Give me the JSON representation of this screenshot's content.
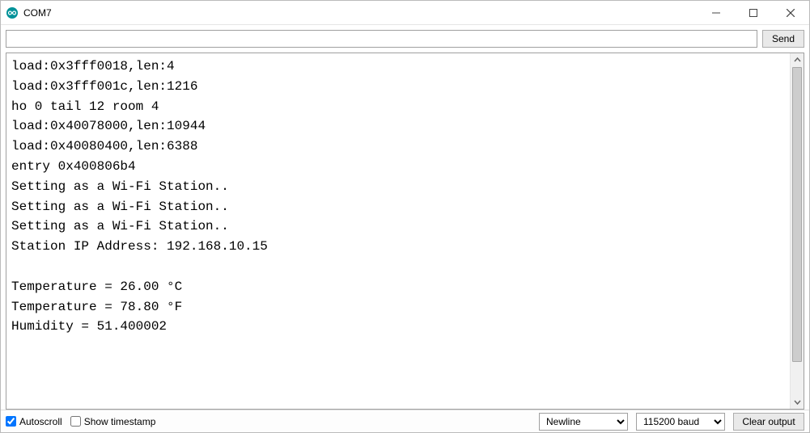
{
  "window": {
    "title": "COM7"
  },
  "input": {
    "command_value": "",
    "send_label": "Send"
  },
  "console": {
    "lines": [
      "load:0x3fff0018,len:4",
      "load:0x3fff001c,len:1216",
      "ho 0 tail 12 room 4",
      "load:0x40078000,len:10944",
      "load:0x40080400,len:6388",
      "entry 0x400806b4",
      "Setting as a Wi-Fi Station..",
      "Setting as a Wi-Fi Station..",
      "Setting as a Wi-Fi Station..",
      "Station IP Address: 192.168.10.15",
      "",
      "Temperature = 26.00 °C",
      "Temperature = 78.80 °F",
      "Humidity = 51.400002"
    ]
  },
  "bottom": {
    "autoscroll_label": "Autoscroll",
    "autoscroll_checked": true,
    "timestamp_label": "Show timestamp",
    "timestamp_checked": false,
    "line_ending_selected": "Newline",
    "baud_selected": "115200 baud",
    "clear_label": "Clear output"
  }
}
